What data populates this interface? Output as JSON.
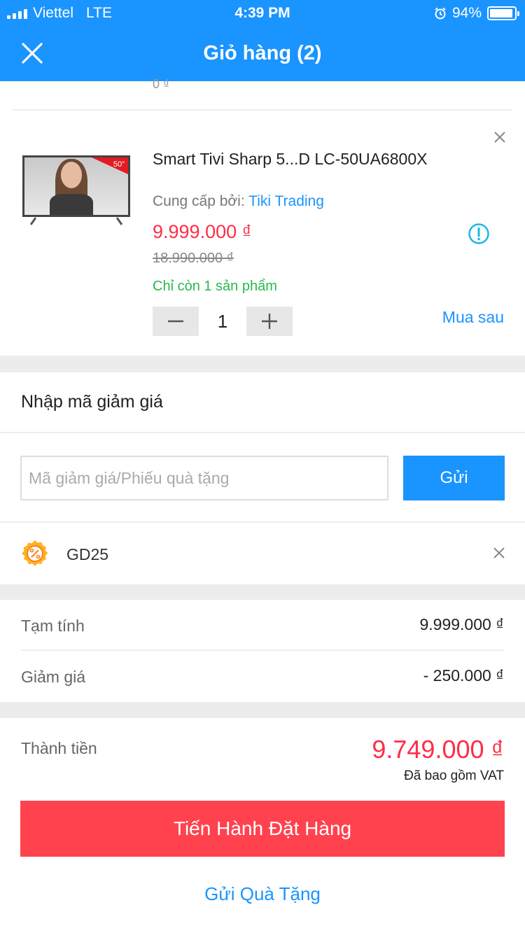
{
  "status_bar": {
    "carrier": "Viettel",
    "network": "LTE",
    "time": "4:39 PM",
    "battery": "94%",
    "battery_level": 0.94
  },
  "header": {
    "title": "Giỏ hàng (2)"
  },
  "cart": {
    "previous_item_clipped_text": "0 ₫",
    "item": {
      "image_badge": "50\"",
      "name": "Smart Tivi Sharp 5...D LC-50UA6800X",
      "seller_prefix": "Cung cấp bởi:",
      "seller_name": "Tiki Trading",
      "price": "9.999.000 ₫",
      "original_price": "18.990.000 ₫",
      "stock_note": "Chỉ còn 1 sản phẩm",
      "quantity": "1",
      "buy_later_label": "Mua sau"
    }
  },
  "coupon": {
    "heading": "Nhập mã giảm giá",
    "placeholder": "Mã giảm giá/Phiếu quà tặng",
    "submit_label": "Gửi",
    "applied_code": "GD25"
  },
  "summary": {
    "subtotal_label": "Tạm tính",
    "subtotal_value": "9.999.000 ₫",
    "discount_label": "Giảm giá",
    "discount_value": "- 250.000 ₫"
  },
  "total": {
    "label": "Thành tiền",
    "value": "9.749.000 ₫",
    "vat_note": "Đã bao gồm VAT"
  },
  "actions": {
    "checkout_label": "Tiến Hành Đặt Hàng",
    "gift_label": "Gửi Quà Tặng"
  },
  "colors": {
    "primary": "#1a94ff",
    "price_red": "#ff2d47",
    "checkout": "#ff424e",
    "stock_green": "#28b84c"
  }
}
